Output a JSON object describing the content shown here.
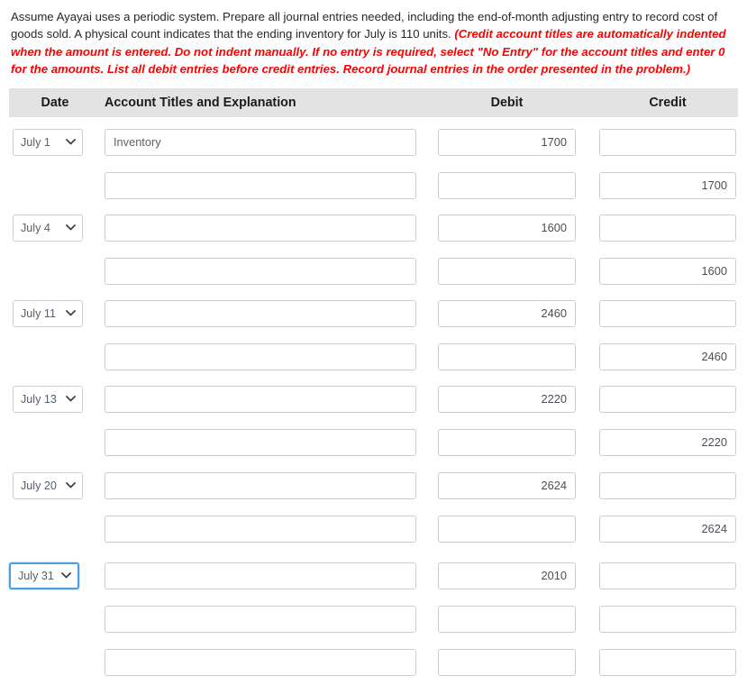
{
  "instructions": {
    "normal": "Assume Ayayai uses a periodic system. Prepare all journal entries needed, including the end-of-month adjusting entry to record cost of goods sold. A physical count indicates that the ending inventory for July is 110 units. ",
    "emphasis": "(Credit account titles are automatically indented when the amount is entered. Do not indent manually. If no entry is required, select \"No Entry\" for the account titles and enter 0 for the amounts. List all debit entries before credit entries. Record journal entries in the order presented in the problem.)"
  },
  "table": {
    "headers": {
      "date": "Date",
      "account": "Account Titles and Explanation",
      "debit": "Debit",
      "credit": "Credit"
    },
    "account_placeholder": "",
    "amount_placeholder": "",
    "rows": [
      {
        "date": "July 1",
        "date_focused": false,
        "account": "Inventory",
        "debit": "1700",
        "credit": ""
      },
      {
        "date": "",
        "date_focused": false,
        "account": "",
        "debit": "",
        "credit": "1700"
      },
      {
        "date": "July 4",
        "date_focused": false,
        "account": "",
        "debit": "1600",
        "credit": ""
      },
      {
        "date": "",
        "date_focused": false,
        "account": "",
        "debit": "",
        "credit": "1600"
      },
      {
        "date": "July 11",
        "date_focused": false,
        "account": "",
        "debit": "2460",
        "credit": ""
      },
      {
        "date": "",
        "date_focused": false,
        "account": "",
        "debit": "",
        "credit": "2460"
      },
      {
        "date": "July 13",
        "date_focused": false,
        "account": "",
        "debit": "2220",
        "credit": ""
      },
      {
        "date": "",
        "date_focused": false,
        "account": "",
        "debit": "",
        "credit": "2220"
      },
      {
        "date": "July 20",
        "date_focused": false,
        "account": "",
        "debit": "2624",
        "credit": ""
      },
      {
        "date": "",
        "date_focused": false,
        "account": "",
        "debit": "",
        "credit": "2624"
      },
      {
        "date": "July 31",
        "date_focused": true,
        "account": "",
        "debit": "2010",
        "credit": ""
      },
      {
        "date": "",
        "date_focused": false,
        "account": "",
        "debit": "",
        "credit": ""
      },
      {
        "date": "",
        "date_focused": false,
        "account": "",
        "debit": "",
        "credit": ""
      }
    ]
  },
  "colors": {
    "header_band": "#e3e3e3",
    "emphasis_red": "#ff0000",
    "focus_blue": "#4a9fe0",
    "input_border": "#cdcdcd"
  },
  "icons": {
    "chevron_down": "chevron-down-icon"
  }
}
